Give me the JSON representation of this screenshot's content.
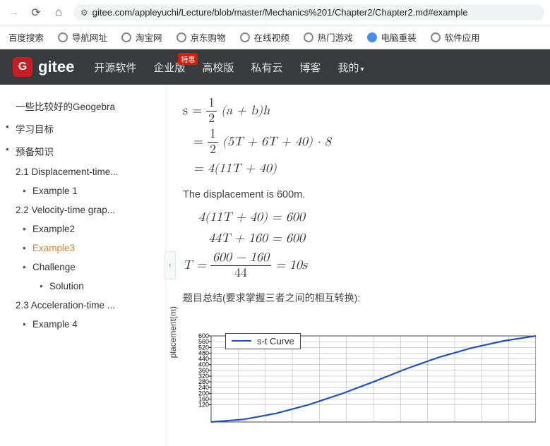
{
  "chrome": {
    "url": "gitee.com/appleyuchi/Lecture/blob/master/Mechanics%201/Chapter2/Chapter2.md#example"
  },
  "bookmarks": [
    "百度搜索",
    "导航网址",
    "淘宝网",
    "京东购物",
    "在线视频",
    "热门游戏",
    "电脑重装",
    "软件应用"
  ],
  "gitee": {
    "nav": [
      "开源软件",
      "企业版",
      "高校版",
      "私有云",
      "博客",
      "我的"
    ],
    "badge": "特惠"
  },
  "toc": [
    {
      "label": "一些比较好的Geogebra",
      "level": 1,
      "active": false,
      "truncated": true
    },
    {
      "label": "学习目标",
      "level": 1,
      "active": false
    },
    {
      "label": "预备知识",
      "level": 1,
      "active": false
    },
    {
      "label": "2.1 Displacement-time...",
      "level": 1,
      "active": false,
      "truncated": true
    },
    {
      "label": "Example 1",
      "level": 2,
      "active": false
    },
    {
      "label": "2.2 Velocity-time grap...",
      "level": 1,
      "active": false,
      "truncated": true
    },
    {
      "label": "Example2",
      "level": 2,
      "active": false
    },
    {
      "label": "Example3",
      "level": 2,
      "active": true
    },
    {
      "label": "Challenge",
      "level": 2,
      "active": false
    },
    {
      "label": "Solution",
      "level": 3,
      "active": false
    },
    {
      "label": "2.3 Acceleration-time ...",
      "level": 1,
      "active": false,
      "truncated": true
    },
    {
      "label": "Example 4",
      "level": 2,
      "active": false
    }
  ],
  "content": {
    "displacement_text": "The displacement is 600m.",
    "summary_text": "题目总结(要求掌握三者之间的相互转换):",
    "math1": {
      "l1a": "s =",
      "l1_frac_n": "1",
      "l1_frac_d": "2",
      "l1b": "(a + b)h",
      "l2a": "=",
      "l2_frac_n": "1",
      "l2_frac_d": "2",
      "l2b": "(5T + 6T + 40) · 8",
      "l3": "= 4(11T + 40)"
    },
    "math2": {
      "l1": "4(11T + 40) = 600",
      "l2": "44T + 160 = 600",
      "l3a": "T =",
      "l3_frac_n": "600 − 160",
      "l3_frac_d": "44",
      "l3b": "= 10s"
    }
  },
  "chart_data": {
    "type": "line",
    "title": "",
    "xlabel": "",
    "ylabel": "placement(m)",
    "legend": "s-t Curve",
    "ylim": [
      0,
      600
    ],
    "y_ticks": [
      120,
      160,
      200,
      240,
      280,
      320,
      360,
      400,
      440,
      480,
      520,
      560,
      600
    ],
    "series": [
      {
        "name": "s-t Curve",
        "color": "#2050c8",
        "x": [
          0,
          1,
          2,
          3,
          4,
          5,
          6,
          7,
          8,
          9,
          10
        ],
        "y": [
          0,
          18,
          60,
          120,
          195,
          280,
          370,
          450,
          515,
          565,
          600
        ]
      }
    ]
  }
}
